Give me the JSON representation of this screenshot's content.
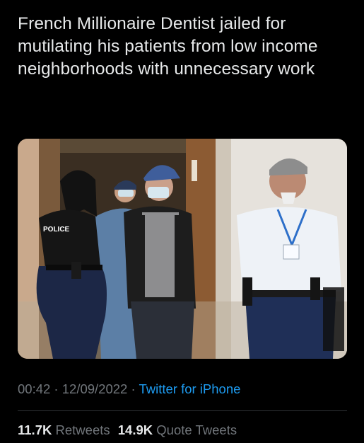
{
  "tweet": {
    "text": "French Millionaire Dentist jailed for mutilating his patients from low income neighborhoods with unnecessary work",
    "photo_vest_text": "POLICE"
  },
  "meta": {
    "time": "00:42",
    "separator": " · ",
    "date": "12/09/2022",
    "source": "Twitter for iPhone"
  },
  "stats": {
    "retweets_count": "11.7K",
    "retweets_label": "Retweets",
    "quotes_count": "14.9K",
    "quotes_label": "Quote Tweets"
  },
  "colors": {
    "background": "#000000",
    "text": "#e7e9ea",
    "secondary": "#71767b",
    "link": "#1d9bf0",
    "divider": "#2f3336"
  }
}
